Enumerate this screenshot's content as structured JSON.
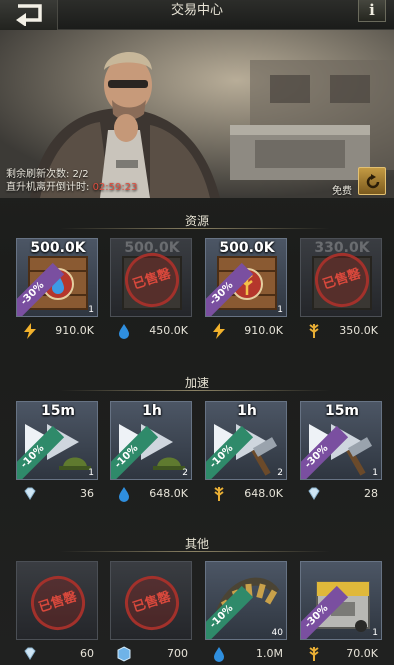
{
  "header": {
    "title": "交易中心",
    "info_label": "i"
  },
  "banner": {
    "refresh_text": "剩余刷新次数: 2/2",
    "timer_label": "直升机离开倒计时:",
    "timer_value": "02:59:23",
    "free_label": "免费"
  },
  "sections": {
    "resources": {
      "title": "资源",
      "items": [
        {
          "label": "500.0K",
          "discount": "-30%",
          "qty": "1",
          "price": "910.0K",
          "currency": "lightning-icon",
          "sold_out": false
        },
        {
          "label": "500.0K",
          "discount": "",
          "qty": "",
          "price": "450.0K",
          "currency": "water-drop-icon",
          "sold_out": true,
          "sold_text": "已售罄"
        },
        {
          "label": "500.0K",
          "discount": "-30%",
          "qty": "1",
          "price": "910.0K",
          "currency": "wheat-icon",
          "sold_out": false
        },
        {
          "label": "330.0K",
          "discount": "",
          "qty": "",
          "price": "350.0K",
          "currency": "wheat-icon",
          "sold_out": true,
          "sold_text": "已售罄"
        }
      ]
    },
    "speedups": {
      "title": "加速",
      "items": [
        {
          "label": "15m",
          "discount": "-10%",
          "qty": "1",
          "price": "36",
          "currency": "diamond-icon"
        },
        {
          "label": "1h",
          "discount": "-10%",
          "qty": "2",
          "price": "648.0K",
          "currency": "water-drop-icon"
        },
        {
          "label": "1h",
          "discount": "-10%",
          "qty": "2",
          "price": "648.0K",
          "currency": "wheat-icon"
        },
        {
          "label": "15m",
          "discount": "-30%",
          "qty": "1",
          "price": "28",
          "currency": "diamond-icon"
        }
      ]
    },
    "others": {
      "title": "其他",
      "items": [
        {
          "sold_out": true,
          "sold_text": "已售罄",
          "price": "60",
          "currency": "diamond-icon"
        },
        {
          "sold_out": true,
          "sold_text": "已售罄",
          "price": "700",
          "currency": "cube-icon"
        },
        {
          "discount": "-10%",
          "qty": "40",
          "price": "1.0M",
          "currency": "water-drop-icon"
        },
        {
          "discount": "-30%",
          "qty": "1",
          "price": "70.0K",
          "currency": "wheat-icon"
        }
      ]
    }
  }
}
